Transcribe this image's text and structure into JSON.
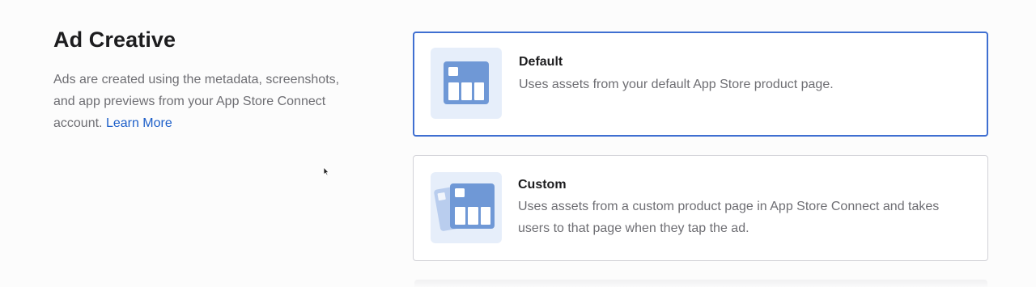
{
  "section": {
    "title": "Ad Creative",
    "description": "Ads are created using the metadata, screenshots, and app previews from your App Store Connect account.",
    "learn_more": "Learn More"
  },
  "options": [
    {
      "title": "Default",
      "description": "Uses assets from your default App Store product page.",
      "icon": "default-product-page-icon",
      "selected": true
    },
    {
      "title": "Custom",
      "description": "Uses assets from a custom product page in App Store Connect and takes users to that page when they tap the ad.",
      "icon": "custom-product-page-icon",
      "selected": false
    }
  ],
  "colors": {
    "accent": "#3f6fd1",
    "link": "#1d5fc9",
    "icon_fill": "#6f98d6",
    "icon_bg": "#e6eefa"
  }
}
